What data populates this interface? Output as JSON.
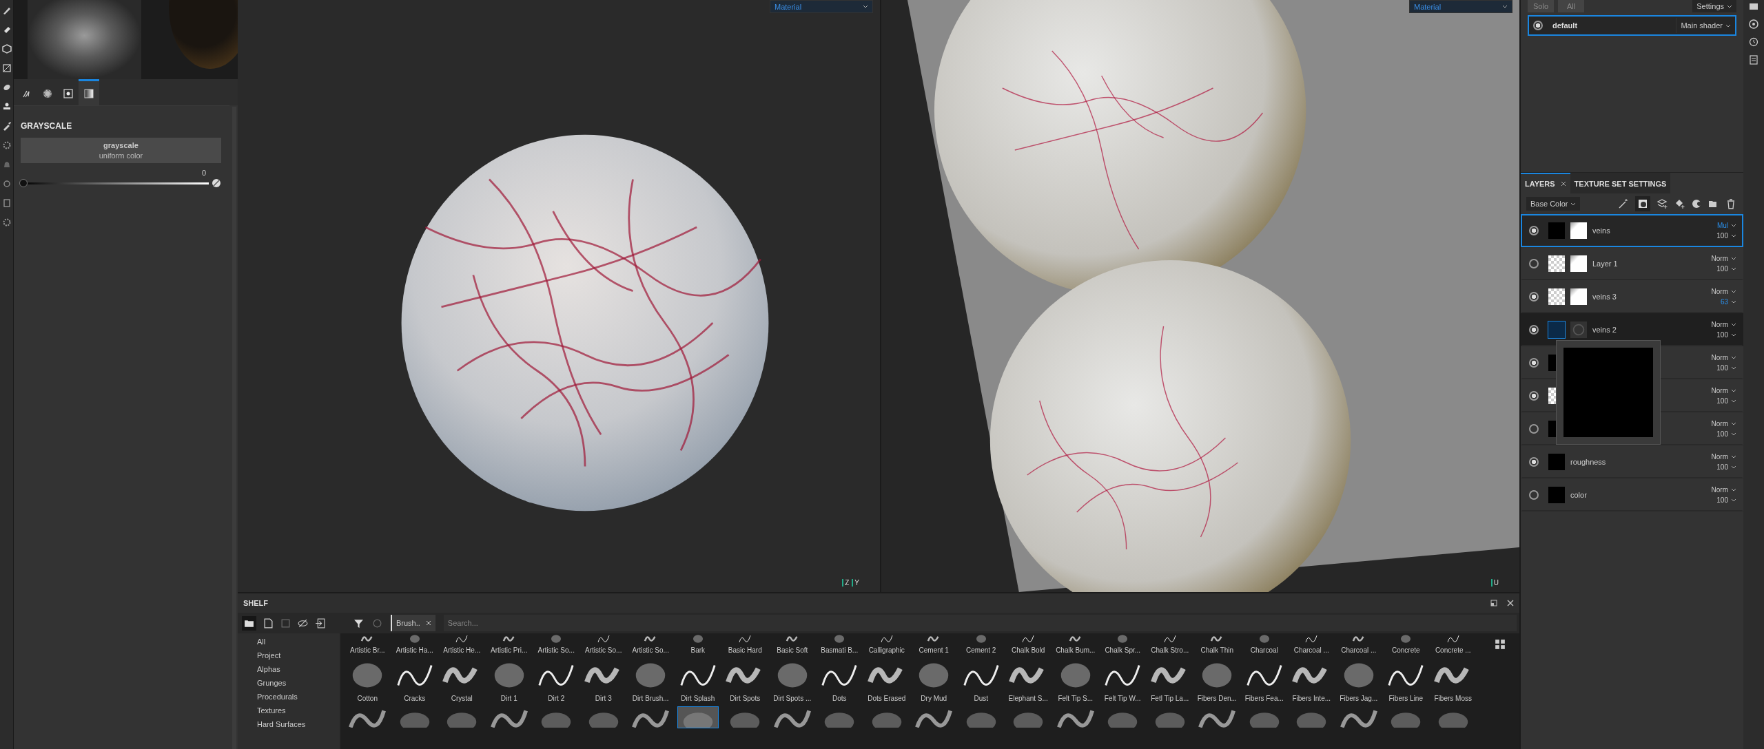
{
  "left_panel": {
    "tabs": [
      {
        "selected": false
      },
      {
        "selected": false
      },
      {
        "selected": false
      },
      {
        "selected": true
      }
    ],
    "section_title": "GRAYSCALE",
    "source_button": {
      "title": "grayscale",
      "subtitle": "uniform color"
    },
    "slider": {
      "value": "0",
      "level": 0
    }
  },
  "viewports": [
    {
      "kind": "model",
      "dropdown": "Material",
      "gizmo": [
        "Z",
        "Y"
      ]
    },
    {
      "kind": "uv",
      "dropdown": "Material",
      "gizmo": [
        "U"
      ]
    }
  ],
  "shelf": {
    "title": "SHELF",
    "categories": [
      "All",
      "Project",
      "Alphas",
      "Grunges",
      "Procedurals",
      "Textures",
      "Hard Surfaces"
    ],
    "filter_chip": "Brush..",
    "search": {
      "placeholder": "Search..."
    },
    "rows": [
      [
        "Artistic Br...",
        "Artistic Ha...",
        "Artistic He...",
        "Artistic Pri...",
        "Artistic So...",
        "Artistic So...",
        "Artistic So...",
        "Bark",
        "Basic Hard",
        "Basic Soft",
        "Basmati B...",
        "Calligraphic",
        "Cement 1",
        "Cement 2",
        "Chalk Bold",
        "Chalk Bum...",
        "Chalk Spr...",
        "Chalk Stro...",
        "Chalk Thin",
        "Charcoal",
        "Charcoal ...",
        "Charcoal ...",
        "Concrete",
        "Concrete ..."
      ],
      [
        "Cotton",
        "Cracks",
        "Crystal",
        "Dirt 1",
        "Dirt 2",
        "Dirt 3",
        "Dirt Brush...",
        "Dirt Splash",
        "Dirt Spots",
        "Dirt Spots ...",
        "Dots",
        "Dots Erased",
        "Dry Mud",
        "Dust",
        "Elephant S...",
        "Felt Tip S...",
        "Felt Tip W...",
        "Fetl Tip La...",
        "Fibers Den...",
        "Fibers Fea...",
        "Fibers Inte...",
        "Fibers Jag...",
        "Fibers Line",
        "Fibers Moss"
      ]
    ],
    "partial_row": [
      {
        "selected": false
      },
      {
        "selected": false
      },
      {
        "selected": false
      },
      {
        "selected": false
      },
      {
        "selected": false
      },
      {
        "selected": false
      },
      {
        "selected": false
      },
      {
        "selected": true
      },
      {
        "selected": false
      },
      {
        "selected": false
      },
      {
        "selected": false
      },
      {
        "selected": false
      },
      {
        "selected": false
      },
      {
        "selected": false
      },
      {
        "selected": false
      },
      {
        "selected": false
      },
      {
        "selected": false
      },
      {
        "selected": false
      },
      {
        "selected": false
      },
      {
        "selected": false
      },
      {
        "selected": false
      },
      {
        "selected": false
      },
      {
        "selected": false
      },
      {
        "selected": false
      }
    ]
  },
  "texture_sets": {
    "buttons": [
      {
        "label": "Solo",
        "disabled": true
      },
      {
        "label": "All",
        "disabled": true
      }
    ],
    "settings": "Settings",
    "items": [
      {
        "name": "default",
        "shader": "Main shader",
        "selected": true
      }
    ]
  },
  "layers_panel": {
    "tabs": [
      {
        "label": "LAYERS",
        "selected": true,
        "closable": true
      },
      {
        "label": "TEXTURE SET SETTINGS",
        "selected": false,
        "closable": false
      }
    ],
    "channel": "Base Color",
    "layers": [
      {
        "kind": "paint",
        "name": "veins",
        "visible": true,
        "selected": true,
        "hovered": false,
        "checker": false,
        "blend": "Mul",
        "blend_accent": true,
        "opacity": "100",
        "opacity_accent": false
      },
      {
        "kind": "paint",
        "name": "Layer 1",
        "visible": false,
        "selected": false,
        "hovered": false,
        "checker": true,
        "blend": "Norm",
        "blend_accent": false,
        "opacity": "100",
        "opacity_accent": false
      },
      {
        "kind": "paint",
        "name": "veins 3",
        "visible": true,
        "selected": false,
        "hovered": false,
        "checker": true,
        "blend": "Norm",
        "blend_accent": false,
        "opacity": "63",
        "opacity_accent": true
      },
      {
        "kind": "fill",
        "name": "veins 2",
        "visible": true,
        "selected": false,
        "hovered": true,
        "checker": false,
        "blend": "Norm",
        "blend_accent": false,
        "opacity": "100",
        "opacity_accent": false
      },
      {
        "kind": "plain",
        "visible": true,
        "selected": false,
        "hovered": false,
        "checker": false,
        "blend": "Norm",
        "blend_accent": false,
        "opacity": "100",
        "opacity_accent": false
      },
      {
        "kind": "plain",
        "visible": true,
        "selected": false,
        "hovered": false,
        "checker": true,
        "blend": "Norm",
        "blend_accent": false,
        "opacity": "100",
        "opacity_accent": false
      },
      {
        "kind": "plain",
        "visible": false,
        "selected": false,
        "hovered": false,
        "checker": false,
        "blend": "Norm",
        "blend_accent": false,
        "opacity": "100",
        "opacity_accent": false
      },
      {
        "kind": "plain",
        "name": "roughness",
        "visible": true,
        "selected": false,
        "hovered": false,
        "checker": false,
        "blend": "Norm",
        "blend_accent": false,
        "opacity": "100",
        "opacity_accent": false
      },
      {
        "kind": "plain",
        "name": "color",
        "visible": false,
        "selected": false,
        "hovered": false,
        "checker": false,
        "blend": "Norm",
        "blend_accent": false,
        "opacity": "100",
        "opacity_accent": false
      }
    ]
  }
}
